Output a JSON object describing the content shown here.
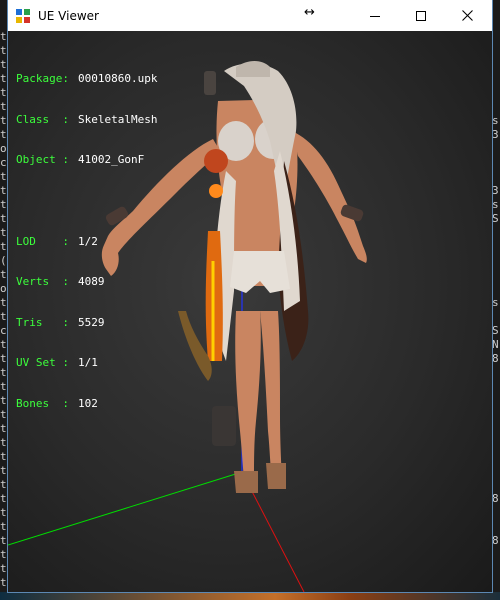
{
  "window": {
    "title": "UE Viewer"
  },
  "info": {
    "package": {
      "label": "Package:",
      "value": "00010860.upk"
    },
    "class": {
      "label": "Class  :",
      "value": "SkeletalMesh"
    },
    "object": {
      "label": "Object :",
      "value": "41002_GonF"
    },
    "lod": {
      "label": "LOD    :",
      "value": "1/2"
    },
    "verts": {
      "label": "Verts  :",
      "value": "4089"
    },
    "tris": {
      "label": "Tris   :",
      "value": "5529"
    },
    "uvset": {
      "label": "UV Set :",
      "value": "1/1"
    },
    "bones": {
      "label": "Bones  :",
      "value": "102"
    }
  },
  "background_console": {
    "left": [
      "t",
      "t",
      "t",
      "t",
      "t",
      "t",
      "t",
      "t",
      "o",
      "c",
      "t",
      "t",
      "t",
      "t",
      "t",
      "t",
      "(",
      "t",
      "o",
      "t",
      "t",
      "c",
      "t",
      "t",
      "t",
      "t",
      "t",
      "t",
      "t",
      "t",
      "t",
      "t",
      "t",
      "t",
      "t",
      "t",
      "t",
      "t",
      "t",
      "t"
    ],
    "right": [
      "",
      "",
      "",
      "",
      "",
      "",
      "s",
      "3",
      "",
      "",
      "",
      "3",
      "s",
      "S",
      "",
      "",
      "",
      "",
      "",
      "s",
      "",
      "S",
      "N",
      "8",
      "",
      "",
      "",
      "",
      "",
      "",
      "",
      "",
      "",
      "8",
      "",
      "",
      "8",
      "",
      "",
      ""
    ]
  },
  "colors": {
    "info_key": "#3cff3c",
    "info_value": "#ffffff",
    "axis_x": "#00dd00",
    "axis_y": "#dd1111",
    "axis_z": "#2233ff"
  }
}
